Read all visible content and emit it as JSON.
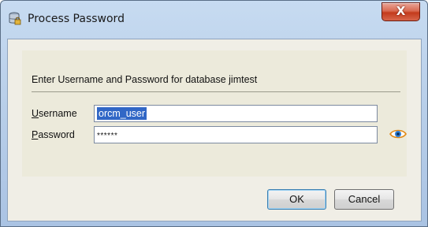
{
  "window": {
    "title": "Process Password",
    "close_label": "X"
  },
  "form": {
    "prompt": "Enter Username and Password for database jimtest",
    "username_label_accel": "U",
    "username_label_rest": "sername",
    "username_value": "orcm_user",
    "password_label_accel": "P",
    "password_label_rest": "assword",
    "password_value": "******"
  },
  "buttons": {
    "ok": "OK",
    "cancel": "Cancel"
  },
  "icons": {
    "title": "database-lock-icon",
    "reveal": "eye-icon"
  },
  "colors": {
    "selection": "#3167c6",
    "close": "#c33a1c",
    "panel": "#eceadb"
  }
}
